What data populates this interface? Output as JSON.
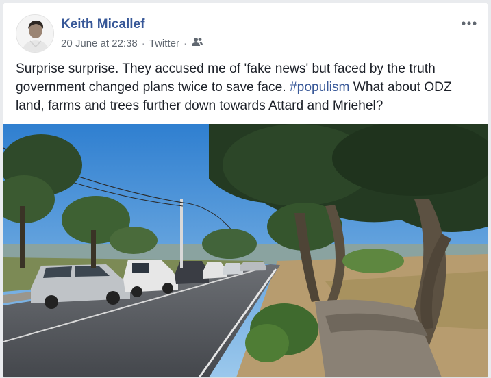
{
  "post": {
    "author": "Keith Micallef",
    "timestamp": "20 June at 22:38",
    "source": "Twitter",
    "separator": "·",
    "text_before": "Surprise surprise. They accused me of 'fake news' but faced by the truth government changed plans twice to save face. ",
    "hashtag": "#populism",
    "text_after": " What about ODZ land, farms and trees further down towards Attard and Mriehel?",
    "audience_icon": "friends-icon",
    "more_icon": "more-options-icon",
    "image_description_icon": "photo"
  },
  "colors": {
    "link": "#385898",
    "text": "#1d2129",
    "meta": "#606770",
    "sky": "#3d8ad6"
  }
}
